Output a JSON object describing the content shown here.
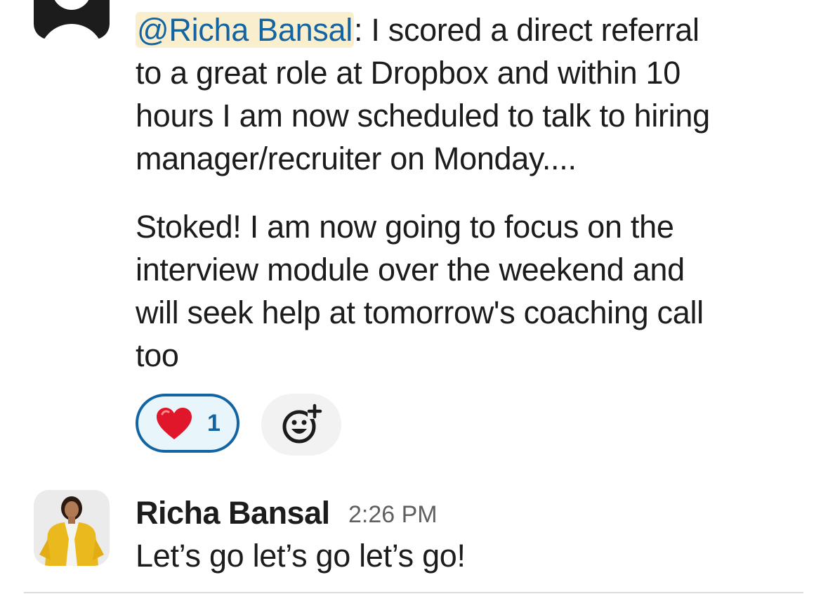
{
  "message1": {
    "mention": "@Richa Bansal",
    "paragraph1_rest": ": I scored a direct referral\nto a great role at Dropbox and within 10\nhours I am now scheduled to talk to hiring\nmanager/recruiter on Monday....",
    "paragraph2": "Stoked! I am now going to focus on the\ninterview module over the weekend and\nwill seek help at tomorrow's coaching call\ntoo",
    "reactions": [
      {
        "emoji": "heart-emoji",
        "count": "1"
      }
    ],
    "add_reaction_icon": "add-reaction-icon"
  },
  "message2": {
    "author": "Richa Bansal",
    "time": "2:26 PM",
    "text": "Let’s go let’s go let’s go!"
  },
  "colors": {
    "link": "#1264a3",
    "mention_bg": "#f9efcf",
    "reaction_bg": "#e8f5fa",
    "text": "#1d1c1d",
    "muted": "#616061"
  }
}
